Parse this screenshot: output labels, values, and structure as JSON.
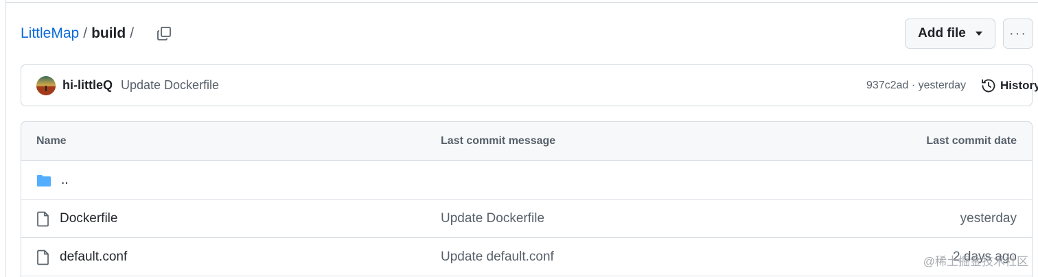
{
  "breadcrumb": {
    "repo": "LittleMap",
    "separator": "/",
    "dir": "build",
    "trailing": "/"
  },
  "toolbar": {
    "add_file_label": "Add file",
    "more_label": "···"
  },
  "commit": {
    "author": "hi-littleQ",
    "message": "Update Dockerfile",
    "meta": "937c2ad · yesterday",
    "history_label": "History"
  },
  "table": {
    "headers": {
      "name": "Name",
      "message": "Last commit message",
      "date": "Last commit date"
    },
    "parent_label": "..",
    "rows": [
      {
        "icon": "file-icon",
        "name": "Dockerfile",
        "message": "Update Dockerfile",
        "date": "yesterday"
      },
      {
        "icon": "file-icon",
        "name": "default.conf",
        "message": "Update default.conf",
        "date": "2 days ago"
      }
    ]
  },
  "watermark": "@稀土掘金技术社区",
  "colors": {
    "link": "#0969da",
    "folder": "#54aeff",
    "muted": "#57606a",
    "border": "#d0d7de"
  }
}
